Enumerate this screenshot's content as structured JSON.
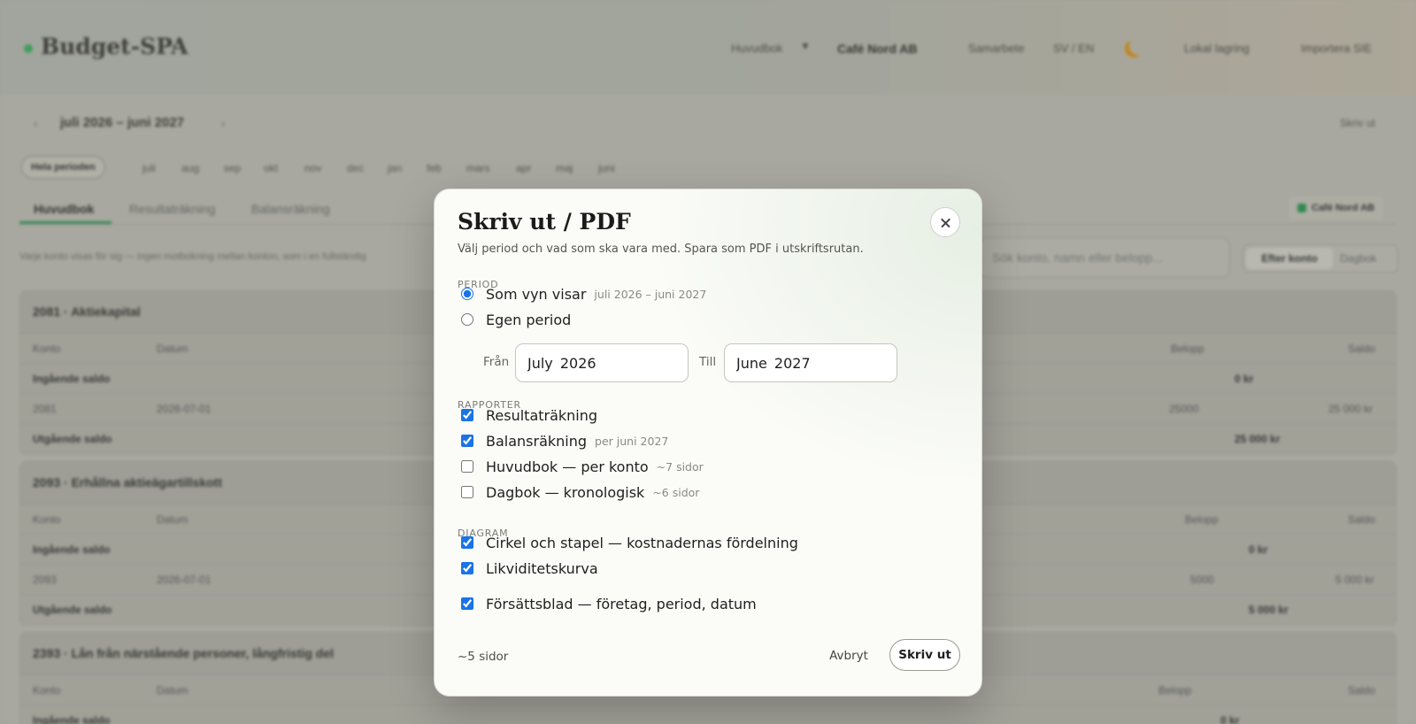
{
  "app": {
    "brand": "Budget-SPA",
    "nav": {
      "ledger": "Huvudbok",
      "company": "Café Nord AB",
      "collab": "Samarbete",
      "lang": "SV / EN",
      "storage": "Lokal lagring",
      "import": "Importera SIE"
    },
    "period": "juli 2026 – juni 2027",
    "print_link": "Skriv ut",
    "whole_period": "Hela perioden",
    "months": [
      "juli",
      "aug",
      "sep",
      "okt",
      "nov",
      "dec",
      "jan",
      "feb",
      "mars",
      "apr",
      "maj",
      "juni"
    ],
    "tabs": [
      "Huvudbok",
      "Resultaträkning",
      "Balansräkning"
    ],
    "company_chip": "Café Nord AB",
    "hint": "Varje konto visas för sig — ingen motbokning mellan konton, som i en fullständig",
    "search_placeholder": "Sök konto, namn eller belopp...",
    "view_by_account": "Efter konto",
    "view_journal": "Dagbok",
    "columns": {
      "account": "Konto",
      "date": "Datum",
      "amount": "Belopp",
      "balance": "Saldo"
    },
    "cards": [
      {
        "title": "2081 · Aktiekapital",
        "opening_label": "Ingående saldo",
        "opening": "0 kr",
        "row_account": "2081",
        "row_date": "2026-07-01",
        "row_amount": "25000",
        "row_balance": "25 000 kr",
        "closing_label": "Utgående saldo",
        "closing": "25 000 kr"
      },
      {
        "title": "2093 · Erhållna aktieägartillskott",
        "opening_label": "Ingående saldo",
        "opening": "0 kr",
        "row_account": "2093",
        "row_date": "2026-07-01",
        "row_amount": "5000",
        "row_balance": "5 000 kr",
        "closing_label": "Utgående saldo",
        "closing": "5 000 kr"
      },
      {
        "title": "2393 · Lån från närstående personer, långfristig del",
        "opening_label": "Ingående saldo",
        "opening": "0 kr"
      }
    ]
  },
  "modal": {
    "title": "Skriv ut / PDF",
    "subtitle": "Välj period och vad som ska vara med. Spara som PDF i utskriftsrutan.",
    "period_heading": "PERIOD",
    "period_options": [
      {
        "label": "Som vyn visar",
        "note": "juli 2026 – juni 2027",
        "checked": true
      },
      {
        "label": "Egen period",
        "note": "",
        "checked": false
      }
    ],
    "from_label": "Från",
    "from_value": "July 2026",
    "to_label": "Till",
    "to_value": "June 2027",
    "reports_heading": "RAPPORTER",
    "reports": [
      {
        "label": "Resultaträkning",
        "note": "",
        "checked": true
      },
      {
        "label": "Balansräkning",
        "note": "per juni 2027",
        "checked": true
      },
      {
        "label": "Huvudbok — per konto",
        "note": "~7 sidor",
        "checked": false
      },
      {
        "label": "Dagbok — kronologisk",
        "note": "~6 sidor",
        "checked": false
      }
    ],
    "charts_heading": "DIAGRAM",
    "charts": [
      {
        "label": "Cirkel och stapel — kostnadernas fördelning",
        "checked": true
      },
      {
        "label": "Likviditetskurva",
        "checked": true
      }
    ],
    "cover": {
      "label": "Försättsblad — företag, period, datum",
      "checked": true
    },
    "page_count": "~5 sidor",
    "cancel": "Avbryt",
    "print": "Skriv ut",
    "accent": "#1a73e8"
  }
}
